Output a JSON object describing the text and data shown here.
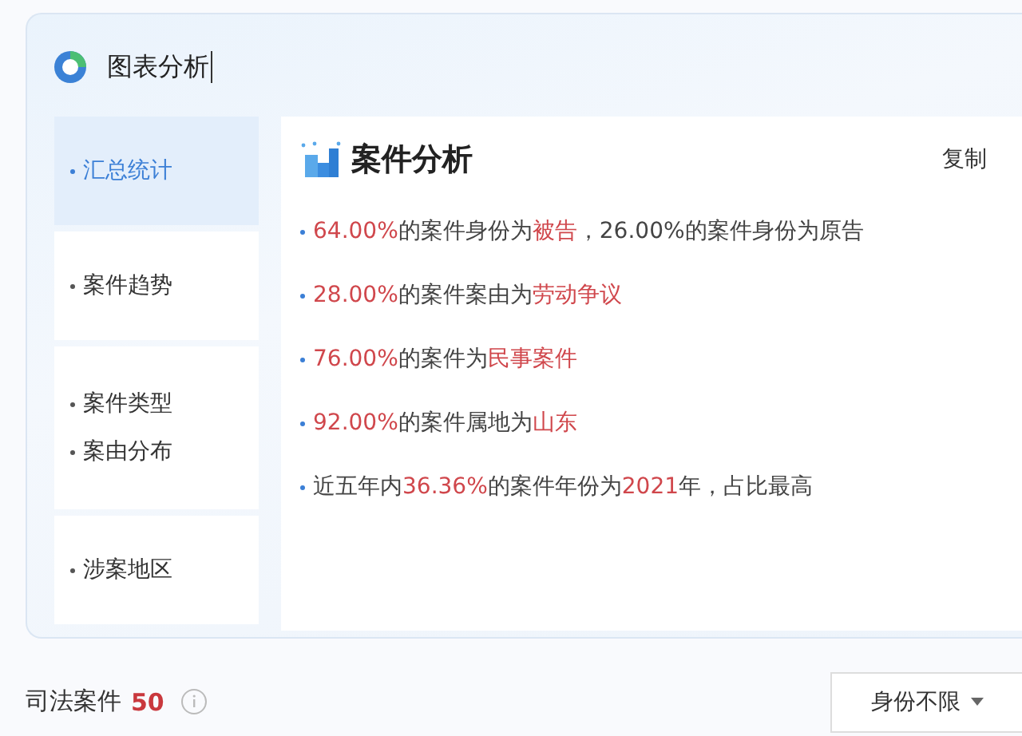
{
  "header": {
    "title": "图表分析"
  },
  "sidebar": {
    "items": [
      {
        "lines": [
          "汇总统计"
        ],
        "selected": true
      },
      {
        "lines": [
          "案件趋势"
        ],
        "selected": false
      },
      {
        "lines": [
          "案件类型",
          "案由分布"
        ],
        "selected": false
      },
      {
        "lines": [
          "涉案地区"
        ],
        "selected": false
      }
    ]
  },
  "card": {
    "title": "案件分析",
    "copy_button": "复制",
    "facts": [
      [
        {
          "text": "64.00%",
          "highlight": true
        },
        {
          "text": "的案件身份为",
          "highlight": false
        },
        {
          "text": "被告",
          "highlight": true
        },
        {
          "text": "，26.00%的案件身份为原告",
          "highlight": false
        }
      ],
      [
        {
          "text": "28.00%",
          "highlight": true
        },
        {
          "text": "的案件案由为",
          "highlight": false
        },
        {
          "text": "劳动争议",
          "highlight": true
        }
      ],
      [
        {
          "text": "76.00%",
          "highlight": true
        },
        {
          "text": "的案件为",
          "highlight": false
        },
        {
          "text": "民事案件",
          "highlight": true
        }
      ],
      [
        {
          "text": "92.00%",
          "highlight": true
        },
        {
          "text": "的案件属地为",
          "highlight": false
        },
        {
          "text": "山东",
          "highlight": true
        }
      ],
      [
        {
          "text": "近五年内",
          "highlight": false
        },
        {
          "text": "36.36%",
          "highlight": true
        },
        {
          "text": "的案件年份为",
          "highlight": false
        },
        {
          "text": "2021",
          "highlight": true
        },
        {
          "text": "年，占比最高",
          "highlight": false
        }
      ]
    ]
  },
  "footer": {
    "label": "司法案件",
    "count": "50",
    "filter": "身份不限"
  }
}
